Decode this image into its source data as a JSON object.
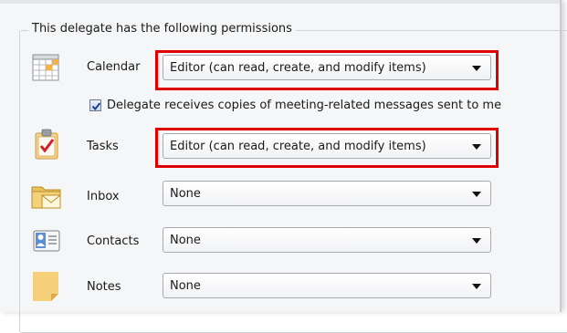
{
  "permissions": {
    "group_title": "This delegate has the following permissions",
    "calendar": {
      "label": "Calendar",
      "value": "Editor (can read, create, and modify items)",
      "highlighted": true
    },
    "meeting_copies": {
      "label": "Delegate receives copies of meeting-related messages sent to me",
      "checked": true
    },
    "tasks": {
      "label": "Tasks",
      "value": "Editor (can read, create, and modify items)",
      "highlighted": true
    },
    "inbox": {
      "label": "Inbox",
      "value": "None"
    },
    "contacts": {
      "label": "Contacts",
      "value": "None"
    },
    "notes": {
      "label": "Notes",
      "value": "None"
    }
  },
  "colors": {
    "highlight": "#e10000",
    "dialog_bg": "#f5f6f7"
  },
  "icons": [
    "calendar-icon",
    "tasks-icon",
    "inbox-folder-icon",
    "contacts-icon",
    "notes-icon",
    "dropdown-arrow-icon",
    "checkmark-icon"
  ]
}
